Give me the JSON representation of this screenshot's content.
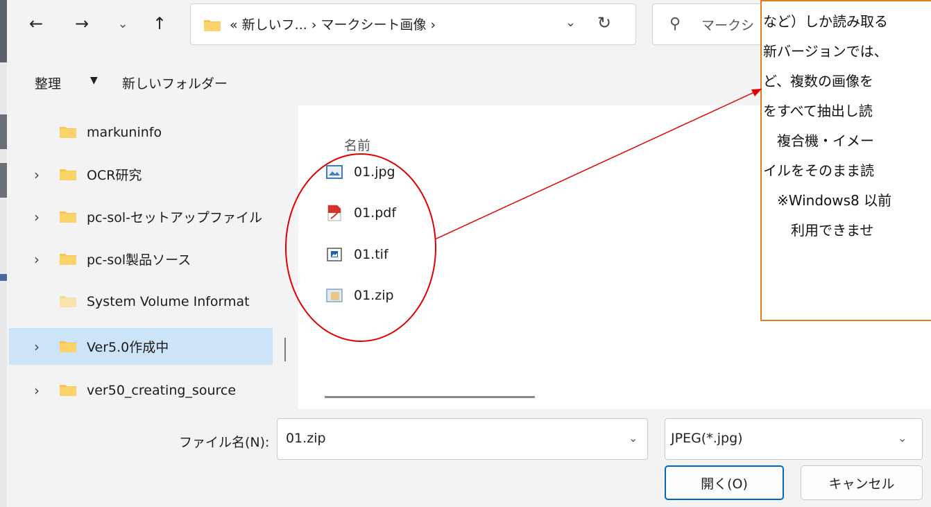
{
  "nav": {
    "back": "←",
    "forward": "→",
    "recent": "⌄",
    "up": "↑"
  },
  "address": {
    "path": "« 新しいフ... › マークシート画像 ›",
    "dropdown": "⌄",
    "refresh": "↻"
  },
  "search": {
    "icon": "⚲",
    "placeholder": "マークシ"
  },
  "toolbar": {
    "organize": "整理",
    "organize_caret": "▼",
    "new_folder": "新しいフォルダー"
  },
  "sidebar": {
    "items": [
      {
        "label": "markuninfo",
        "chevron": ""
      },
      {
        "label": "OCR研究",
        "chevron": "›"
      },
      {
        "label": "pc-sol-セットアップファイル",
        "chevron": "›"
      },
      {
        "label": "pc-sol製品ソース",
        "chevron": "›"
      },
      {
        "label": "System Volume Informat",
        "chevron": ""
      },
      {
        "label": "Ver5.0作成中",
        "chevron": "›",
        "selected": true
      },
      {
        "label": "ver50_creating_source",
        "chevron": "›"
      }
    ]
  },
  "content": {
    "column_name": "名前",
    "files": [
      {
        "name": "01.jpg",
        "icon": "jpg-image-icon"
      },
      {
        "name": "01.pdf",
        "icon": "pdf-file-icon"
      },
      {
        "name": "01.tif",
        "icon": "tif-image-icon"
      },
      {
        "name": "01.zip",
        "icon": "zip-archive-icon"
      }
    ]
  },
  "callout": {
    "lines": [
      "など）しか読み取る",
      "新バージョンでは、",
      "ど、複数の画像を",
      "をすべて抽出し読",
      "　複合機・イメー",
      "イルをそのまま読",
      "　※Windows8 以前",
      "　　利用できませ"
    ],
    "border_color": "#e47d22"
  },
  "footer": {
    "filename_label": "ファイル名(N):",
    "filename_value": "01.zip",
    "filetype_value": "JPEG(*.jpg)",
    "open_label": "開く(O)",
    "cancel_label": "キャンセル"
  },
  "colors": {
    "selection": "#cce4f7",
    "folder": "#f8c44f",
    "annotation_red": "#e00000",
    "primary_button_border": "#0067c0"
  }
}
